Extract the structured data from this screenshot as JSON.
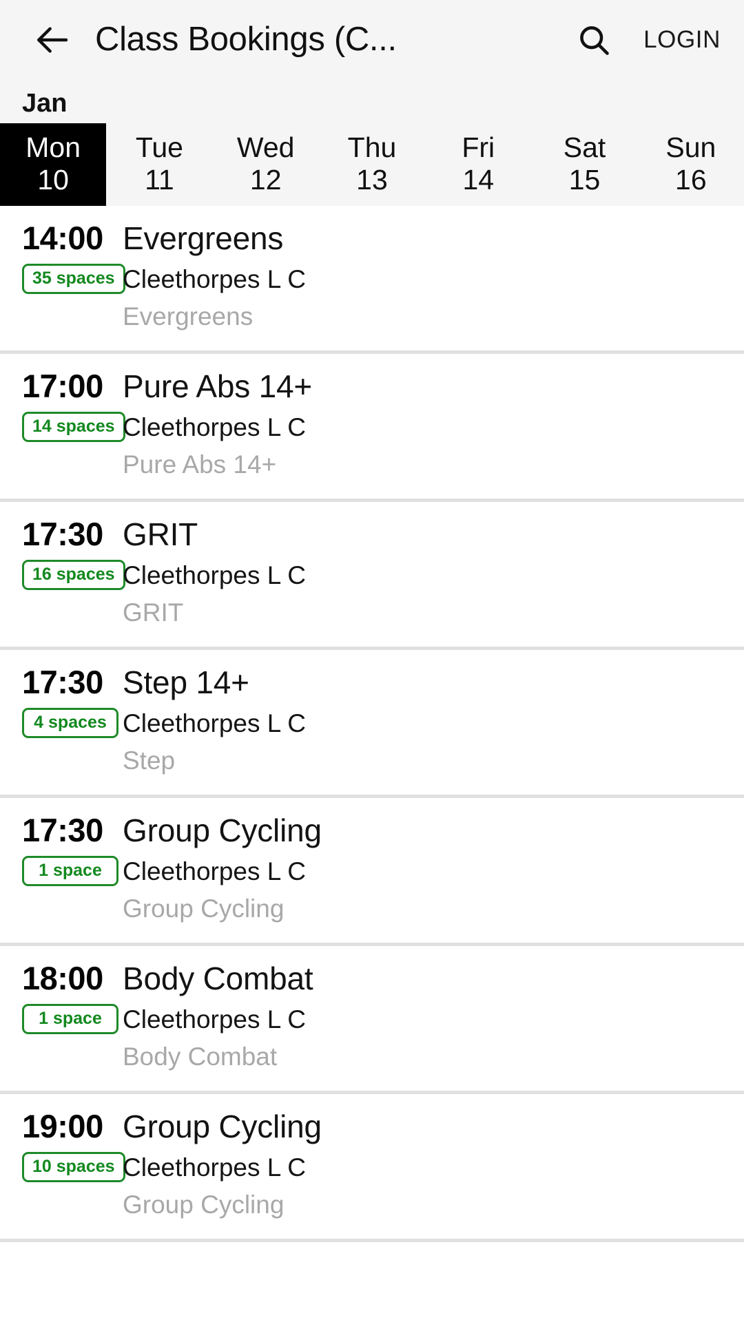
{
  "appbar": {
    "back_icon": "arrow-left-icon",
    "title": "Class Bookings (C...",
    "search_icon": "search-icon",
    "login_label": "LOGIN"
  },
  "calendar": {
    "month_label": "Jan",
    "days": [
      {
        "name": "Mon",
        "num": "10",
        "selected": true
      },
      {
        "name": "Tue",
        "num": "11",
        "selected": false
      },
      {
        "name": "Wed",
        "num": "12",
        "selected": false
      },
      {
        "name": "Thu",
        "num": "13",
        "selected": false
      },
      {
        "name": "Fri",
        "num": "14",
        "selected": false
      },
      {
        "name": "Sat",
        "num": "15",
        "selected": false
      },
      {
        "name": "Sun",
        "num": "16",
        "selected": false
      }
    ]
  },
  "colors": {
    "accent_green": "#13891f",
    "badge_border": "#1e8a28",
    "selected_day_bg": "#000000",
    "header_bg": "#f5f5f5",
    "row_divider": "#e0e0e0",
    "muted_text": "#a8a8a8"
  },
  "classes": [
    {
      "time": "14:00",
      "spaces": "35 spaces",
      "title": "Evergreens",
      "venue": "Cleethorpes L C",
      "subtitle": "Evergreens"
    },
    {
      "time": "17:00",
      "spaces": "14 spaces",
      "title": "Pure Abs 14+",
      "venue": "Cleethorpes L C",
      "subtitle": "Pure Abs 14+"
    },
    {
      "time": "17:30",
      "spaces": "16 spaces",
      "title": "GRIT",
      "venue": "Cleethorpes L C",
      "subtitle": "GRIT"
    },
    {
      "time": "17:30",
      "spaces": "4 spaces",
      "title": "Step 14+",
      "venue": "Cleethorpes L C",
      "subtitle": "Step"
    },
    {
      "time": "17:30",
      "spaces": "1 space",
      "title": "Group Cycling",
      "venue": "Cleethorpes L C",
      "subtitle": "Group Cycling"
    },
    {
      "time": "18:00",
      "spaces": "1 space",
      "title": "Body Combat",
      "venue": "Cleethorpes L C",
      "subtitle": "Body Combat"
    },
    {
      "time": "19:00",
      "spaces": "10 spaces",
      "title": "Group Cycling",
      "venue": "Cleethorpes L C",
      "subtitle": "Group Cycling"
    }
  ]
}
